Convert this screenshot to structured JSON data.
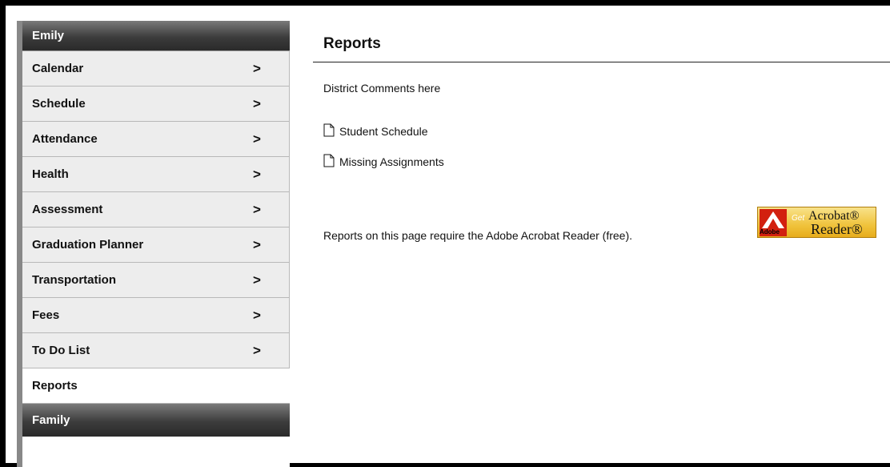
{
  "sidebar": {
    "student_name": "Emily",
    "items": [
      {
        "label": "Calendar",
        "chevron": ">"
      },
      {
        "label": "Schedule",
        "chevron": ">"
      },
      {
        "label": "Attendance",
        "chevron": ">"
      },
      {
        "label": "Health",
        "chevron": ">"
      },
      {
        "label": "Assessment",
        "chevron": ">"
      },
      {
        "label": "Graduation Planner",
        "chevron": ">"
      },
      {
        "label": "Transportation",
        "chevron": ">"
      },
      {
        "label": "Fees",
        "chevron": ">"
      },
      {
        "label": "To Do List",
        "chevron": ">"
      }
    ],
    "active_item": "Reports",
    "footer": "Family"
  },
  "main": {
    "title": "Reports",
    "district_comment": "District Comments here",
    "reports": [
      {
        "label": "Student Schedule",
        "icon": "document-icon"
      },
      {
        "label": "Missing Assignments",
        "icon": "document-icon"
      }
    ],
    "acrobat_note": "Reports on this page require the Adobe Acrobat Reader (free).",
    "badge": {
      "get": "Get",
      "acrobat": "Acrobat®",
      "reader": "Reader®",
      "adobe": "Adobe"
    }
  },
  "colors": {
    "badge_bg": "#f0c33c",
    "adobe_red": "#d2200f",
    "header_dark": "#3c3c3c"
  }
}
